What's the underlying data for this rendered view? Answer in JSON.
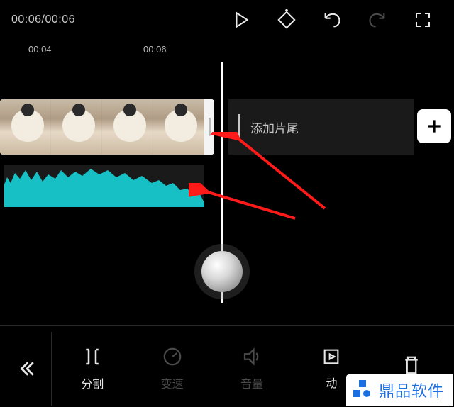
{
  "topbar": {
    "current_time": "00:06",
    "total_time": "00:06",
    "separator": "/"
  },
  "ruler": {
    "ticks": [
      {
        "label": "00:04",
        "pos": 40
      },
      {
        "label": "00:06",
        "pos": 202
      }
    ]
  },
  "timeline": {
    "add_ending_label": "添加片尾"
  },
  "toolbar": {
    "split": "分割",
    "speed": "变速",
    "volume": "音量",
    "animation": "动",
    "delete": ""
  },
  "watermark": {
    "text": "鼎品软件"
  }
}
